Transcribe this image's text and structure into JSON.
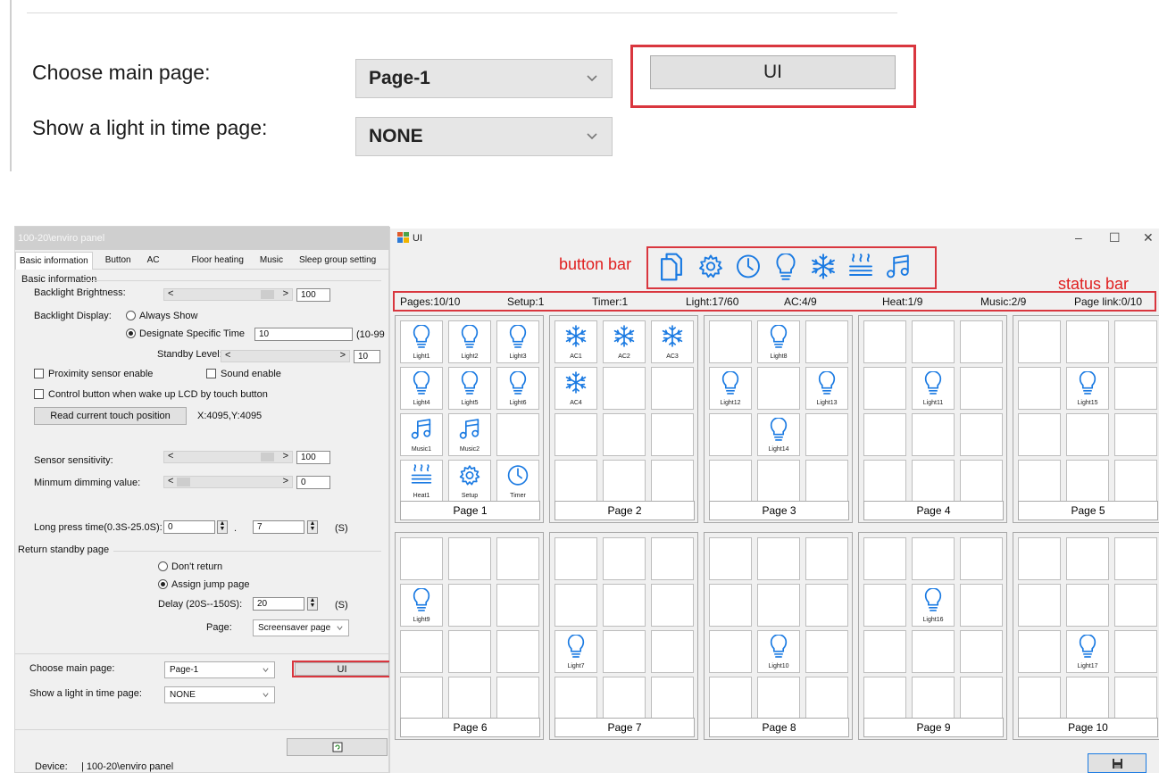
{
  "zoom": {
    "main_label": "Choose main page:",
    "main_value": "Page-1",
    "light_label": "Show a light in time page:",
    "light_value": "NONE",
    "ui_button": "UI"
  },
  "left_window": {
    "title": "100-20\\enviro panel",
    "tabs": [
      "Basic information",
      "Button",
      "AC",
      "Floor heating",
      "Music",
      "Sleep group setting"
    ],
    "group_basic": "Basic information",
    "backlight_brightness": "Backlight Brightness:",
    "backlight_value": "100",
    "backlight_display": "Backlight Display:",
    "always_show": "Always Show",
    "designate_time": "Designate Specific Time",
    "designate_value": "10",
    "designate_range": "(10-99",
    "standby_level": "Standby Level:",
    "standby_value": "10",
    "proximity": "Proximity sensor enable",
    "sound": "Sound enable",
    "control_button": "Control button when wake up LCD by touch button",
    "read_touch": "Read current touch position",
    "touch_pos": "X:4095,Y:4095",
    "sensor_sensitivity": "Sensor sensitivity:",
    "sensor_value": "100",
    "min_dimming": "Minmum dimming value:",
    "min_dimming_value": "0",
    "long_press": "Long press time(0.3S-25.0S):",
    "long_press_int": "0",
    "long_press_dot": ".",
    "long_press_frac": "7",
    "unit_s": "(S)",
    "return_group": "Return standby page",
    "dont_return": "Don't return",
    "assign_jump": "Assign jump page",
    "delay_label": "Delay (20S--150S):",
    "delay_value": "20",
    "page_label": "Page:",
    "page_value": "Screensaver page",
    "choose_main": "Choose main page:",
    "choose_main_value": "Page-1",
    "show_light": "Show a light in time page:",
    "show_light_value": "NONE",
    "ui_button": "UI",
    "device_label": "Device:",
    "device_value": "| 100-20\\enviro panel"
  },
  "ui_window": {
    "title": "UI",
    "minimize": "–",
    "maximize": "☐",
    "close": "✕",
    "button_bar_label": "button bar",
    "status_bar_label": "status bar",
    "button_bar_icons": [
      "pages-icon",
      "gear-icon",
      "clock-icon",
      "bulb-icon",
      "snowflake-icon",
      "heat-icon",
      "music-icon"
    ],
    "status": [
      "Pages:10/10",
      "Setup:1",
      "Timer:1",
      "Light:17/60",
      "AC:4/9",
      "Heat:1/9",
      "Music:2/9",
      "Page link:0/10"
    ],
    "pages": [
      {
        "label": "Page 1",
        "cells": [
          {
            "icon": "bulb",
            "label": "Light1"
          },
          {
            "icon": "bulb",
            "label": "Light2"
          },
          {
            "icon": "bulb",
            "label": "Light3"
          },
          {
            "icon": "bulb",
            "label": "Light4"
          },
          {
            "icon": "bulb",
            "label": "Light5"
          },
          {
            "icon": "bulb",
            "label": "Light6"
          },
          {
            "icon": "music",
            "label": "Music1"
          },
          {
            "icon": "music",
            "label": "Music2"
          },
          null,
          {
            "icon": "heat",
            "label": "Heat1"
          },
          {
            "icon": "gear",
            "label": "Setup"
          },
          {
            "icon": "clock",
            "label": "Timer"
          }
        ]
      },
      {
        "label": "Page 2",
        "cells": [
          {
            "icon": "snow",
            "label": "AC1"
          },
          {
            "icon": "snow",
            "label": "AC2"
          },
          {
            "icon": "snow",
            "label": "AC3"
          },
          {
            "icon": "snow",
            "label": "AC4"
          },
          null,
          null,
          null,
          null,
          null,
          null,
          null,
          null
        ]
      },
      {
        "label": "Page 3",
        "cells": [
          null,
          {
            "icon": "bulb",
            "label": "Light8"
          },
          null,
          {
            "icon": "bulb",
            "label": "Light12"
          },
          null,
          {
            "icon": "bulb",
            "label": "Light13"
          },
          null,
          {
            "icon": "bulb",
            "label": "Light14"
          },
          null,
          null,
          null,
          null
        ]
      },
      {
        "label": "Page 4",
        "cells": [
          null,
          null,
          null,
          null,
          {
            "icon": "bulb",
            "label": "Light11"
          },
          null,
          null,
          null,
          null,
          null,
          null,
          null
        ]
      },
      {
        "label": "Page 5",
        "cells": [
          null,
          null,
          null,
          null,
          {
            "icon": "bulb",
            "label": "Light15"
          },
          null,
          null,
          null,
          null,
          null,
          null,
          null
        ]
      },
      {
        "label": "Page 6",
        "cells": [
          null,
          null,
          null,
          {
            "icon": "bulb",
            "label": "Light9"
          },
          null,
          null,
          null,
          null,
          null,
          null,
          null,
          null
        ]
      },
      {
        "label": "Page 7",
        "cells": [
          null,
          null,
          null,
          null,
          null,
          null,
          {
            "icon": "bulb",
            "label": "Light7"
          },
          null,
          null,
          null,
          null,
          null
        ]
      },
      {
        "label": "Page 8",
        "cells": [
          null,
          null,
          null,
          null,
          null,
          null,
          null,
          {
            "icon": "bulb",
            "label": "Light10"
          },
          null,
          null,
          null,
          null
        ]
      },
      {
        "label": "Page 9",
        "cells": [
          null,
          null,
          null,
          null,
          {
            "icon": "bulb",
            "label": "Light16"
          },
          null,
          null,
          null,
          null,
          null,
          null,
          null
        ]
      },
      {
        "label": "Page 10",
        "cells": [
          null,
          null,
          null,
          null,
          null,
          null,
          null,
          {
            "icon": "bulb",
            "label": "Light17"
          },
          null,
          null,
          null,
          null
        ]
      }
    ]
  },
  "colors": {
    "accent": "#1a7ae2",
    "annotation": "#e02020"
  }
}
